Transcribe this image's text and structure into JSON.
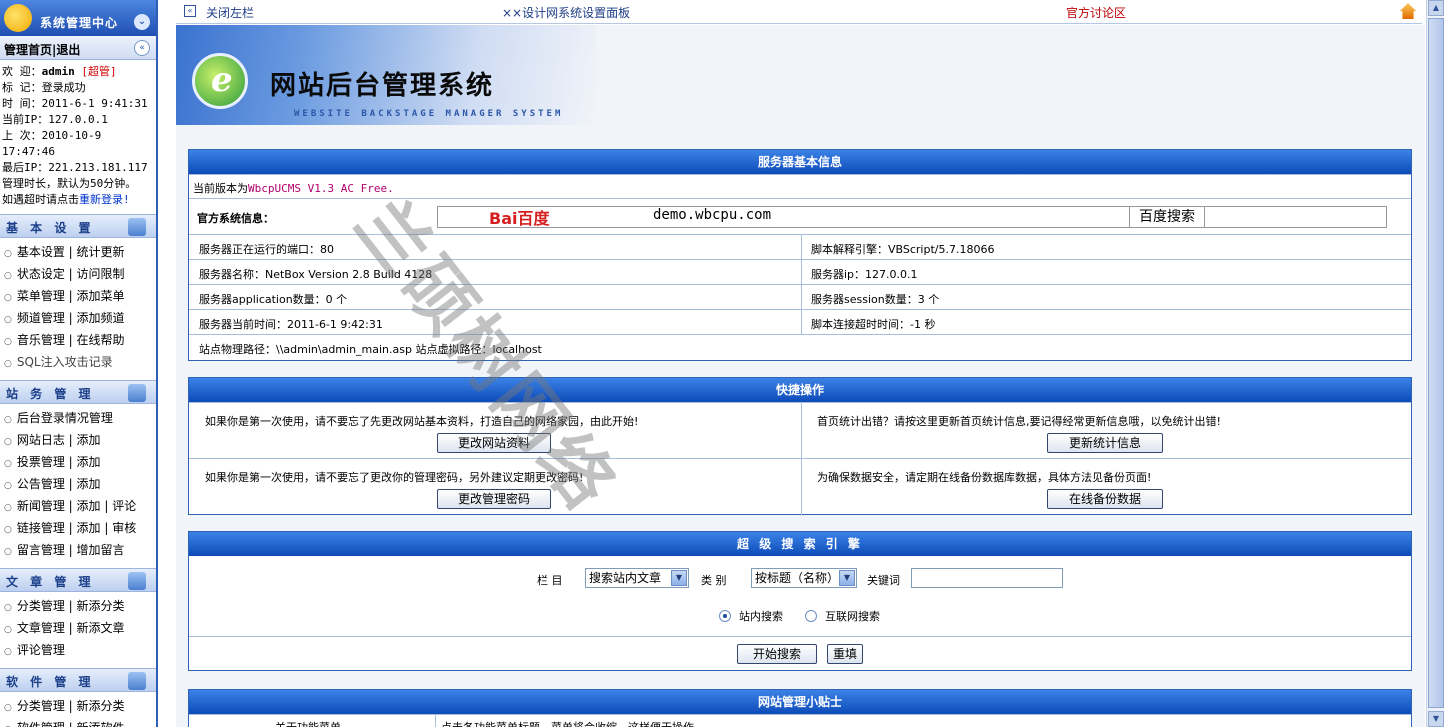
{
  "sidebar": {
    "title": "系统管理中心",
    "home_links": "管理首页|退出",
    "info": {
      "welcome_label": "欢 迎：",
      "welcome_user": "admin",
      "welcome_role": "[超管]",
      "mark": "标 记：登录成功",
      "time": "时 间：2011-6-1 9:41:31",
      "current_ip": "当前IP：127.0.0.1",
      "last_time": "上 次：2010-10-9 17:47:46",
      "last_ip": "最后IP：221.213.181.117",
      "duration": "管理时长，默认为50分钟。",
      "timeout_prefix": "如遇超时请点击",
      "relogin": "重新登录!"
    },
    "sections": [
      {
        "title": "基 本 设 置",
        "items": [
          "基本设置 | 统计更新",
          "状态设定 | 访问限制",
          "菜单管理 | 添加菜单",
          "频道管理 | 添加频道",
          "音乐管理 | 在线帮助",
          "SQL注入攻击记录"
        ]
      },
      {
        "title": "站 务 管 理",
        "items": [
          "后台登录情况管理",
          "网站日志 | 添加",
          "投票管理 | 添加",
          "公告管理 | 添加",
          "新闻管理 | 添加 | 评论",
          "链接管理 | 添加 | 审核",
          "留言管理 | 增加留言"
        ]
      },
      {
        "title": "文 章 管 理",
        "items": [
          "分类管理 | 新添分类",
          "文章管理 | 新添文章",
          "评论管理"
        ]
      },
      {
        "title": "软 件 管 理",
        "items": [
          "分类管理 | 新添分类",
          "软件管理 | 新添软件"
        ]
      }
    ]
  },
  "topbar": {
    "close_left": "关闭左栏",
    "center_title": "××设计网系统设置面板",
    "forum": "官方讨论区"
  },
  "banner": {
    "title": "网站后台管理系统",
    "subtitle": "WEBSITE BACKSTAGE MANAGER SYSTEM"
  },
  "server_info": {
    "header": "服务器基本信息",
    "version_label": "当前版本为",
    "version_value": "WbcpUCMS V1.3 AC Free.",
    "official_label": "官方系统信息：",
    "baidu_logo": "Bai百度",
    "search_value": "demo.wbcpu.com",
    "search_button": "百度搜索",
    "rows": [
      [
        "服务器正在运行的端口：80",
        "脚本解释引擎：VBScript/5.7.18066"
      ],
      [
        "服务器名称：NetBox Version 2.8 Build 4128",
        "服务器ip：127.0.0.1"
      ],
      [
        "服务器application数量：0 个",
        "服务器session数量：3 个"
      ],
      [
        "服务器当前时间：2011-6-1 9:42:31",
        "脚本连接超时时间：-1 秒"
      ]
    ],
    "path_row": "站点物理路径：\\\\admin\\admin_main.asp 站点虚拟路径：localhost"
  },
  "quick_ops": {
    "header": "快捷操作",
    "cells": [
      {
        "text": "如果你是第一次使用，请不要忘了先更改网站基本资料，打造自己的网络家园，由此开始!",
        "button": "更改网站资料"
      },
      {
        "text": "首页统计出错？请按这里更新首页统计信息,要记得经常更新信息哦，以免统计出错!",
        "button": "更新统计信息"
      },
      {
        "text": "如果你是第一次使用，请不要忘了更改你的管理密码，另外建议定期更改密码!",
        "button": "更改管理密码"
      },
      {
        "text": "为确保数据安全，请定期在线备份数据库数据，具体方法见备份页面!",
        "button": "在线备份数据"
      }
    ]
  },
  "super_search": {
    "header": "超 级 搜 索 引 擎",
    "column_label": "栏 目",
    "column_value": "搜索站内文章",
    "type_label": "类 别",
    "type_value": "按标题（名称）",
    "keyword_label": "关键词",
    "keyword_value": "",
    "radio_site": "站内搜索",
    "radio_web": "互联网搜索",
    "start_button": "开始搜索",
    "reset_button": "重填"
  },
  "tips": {
    "header": "网站管理小贴士",
    "row_label": "关于功能菜单",
    "row_text": "点击各功能菜单标题，菜单将会收缩，这样便于操作"
  },
  "watermark": "兰硕树网络",
  "colors": {
    "header_blue": "#0d4bb8",
    "link_red": "#c00000",
    "border_blue": "#3163b5"
  }
}
